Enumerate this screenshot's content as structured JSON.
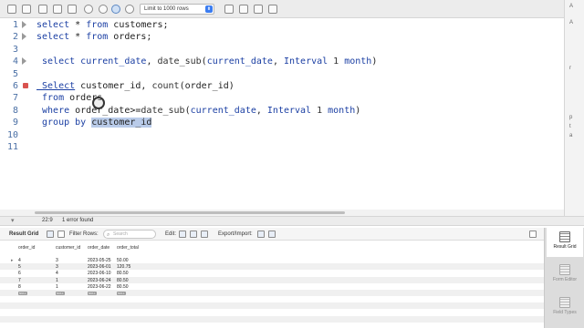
{
  "toolbar": {
    "limit_select": "Limit to 1000 rows"
  },
  "editor": {
    "lines": [
      {
        "n": "1",
        "marker": "tri",
        "tokens": [
          {
            "t": "select",
            "c": "kw"
          },
          {
            "t": " * ",
            "c": ""
          },
          {
            "t": "from",
            "c": "kw"
          },
          {
            "t": " customers;",
            "c": ""
          }
        ]
      },
      {
        "n": "2",
        "marker": "tri",
        "tokens": [
          {
            "t": "select",
            "c": "kw"
          },
          {
            "t": " * ",
            "c": ""
          },
          {
            "t": "from",
            "c": "kw"
          },
          {
            "t": " orders;",
            "c": ""
          }
        ]
      },
      {
        "n": "3",
        "marker": "",
        "tokens": []
      },
      {
        "n": "4",
        "marker": "tri",
        "tokens": [
          {
            "t": " select",
            "c": "kw"
          },
          {
            "t": " current_date",
            "c": "kw"
          },
          {
            "t": ", ",
            "c": ""
          },
          {
            "t": "date_sub",
            "c": "fn"
          },
          {
            "t": "(",
            "c": ""
          },
          {
            "t": "current_date",
            "c": "kw"
          },
          {
            "t": ", ",
            "c": ""
          },
          {
            "t": "Interval",
            "c": "kw"
          },
          {
            "t": " 1 ",
            "c": "num"
          },
          {
            "t": "month",
            "c": "kw"
          },
          {
            "t": ")",
            "c": ""
          }
        ]
      },
      {
        "n": "5",
        "marker": "",
        "tokens": []
      },
      {
        "n": "6",
        "marker": "err",
        "tokens": [
          {
            "t": " Select",
            "c": "kw u"
          },
          {
            "t": " customer_id, ",
            "c": ""
          },
          {
            "t": "count",
            "c": "fn"
          },
          {
            "t": "(order_id)",
            "c": ""
          }
        ]
      },
      {
        "n": "7",
        "marker": "",
        "tokens": [
          {
            "t": " from",
            "c": "kw"
          },
          {
            "t": " orders",
            "c": ""
          }
        ]
      },
      {
        "n": "8",
        "marker": "",
        "tokens": [
          {
            "t": " where",
            "c": "kw"
          },
          {
            "t": " order_date>=",
            "c": ""
          },
          {
            "t": "date_sub",
            "c": "fn"
          },
          {
            "t": "(",
            "c": ""
          },
          {
            "t": "current_date",
            "c": "kw"
          },
          {
            "t": ", ",
            "c": ""
          },
          {
            "t": "Interval",
            "c": "kw"
          },
          {
            "t": " 1 ",
            "c": "num"
          },
          {
            "t": "month",
            "c": "kw"
          },
          {
            "t": ")",
            "c": ""
          }
        ]
      },
      {
        "n": "9",
        "marker": "",
        "tokens": [
          {
            "t": " group by",
            "c": "kw"
          },
          {
            "t": " ",
            "c": ""
          },
          {
            "t": "customer_id",
            "c": "sel"
          }
        ]
      },
      {
        "n": "10",
        "marker": "",
        "tokens": []
      },
      {
        "n": "11",
        "marker": "",
        "tokens": []
      }
    ]
  },
  "side_strip": {
    "letters": [
      "A",
      "A",
      "r",
      "p",
      "t",
      "a"
    ]
  },
  "statusbar": {
    "position": "22:9",
    "errors": "1 error found"
  },
  "result_toolbar": {
    "tab_label": "Result Grid",
    "filter_label": "Filter Rows:",
    "search_placeholder": "Search",
    "edit_label": "Edit:",
    "export_label": "Export/Import:"
  },
  "grid": {
    "columns": [
      "order_id",
      "customer_id",
      "order_date",
      "order_total"
    ],
    "rows": [
      [
        "4",
        "3",
        "2023-05-25",
        "50.00"
      ],
      [
        "5",
        "3",
        "2023-06-01",
        "120.75"
      ],
      [
        "6",
        "4",
        "2023-06-10",
        "80.50"
      ],
      [
        "7",
        "1",
        "2023-06-24",
        "80.50"
      ],
      [
        "8",
        "1",
        "2023-06-22",
        "80.50"
      ]
    ],
    "null_label": "NULL"
  },
  "right_panel": {
    "result_grid": "Result Grid",
    "form_editor": "Form Editor",
    "field_types": "Field Types"
  }
}
